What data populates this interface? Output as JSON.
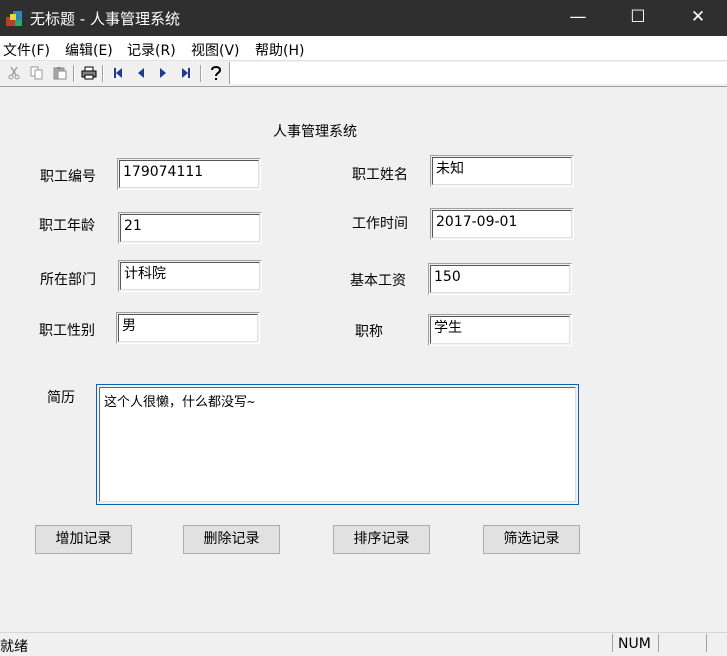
{
  "window": {
    "title": "无标题 - 人事管理系统"
  },
  "menu": [
    "文件(F)",
    "编辑(E)",
    "记录(R)",
    "视图(V)",
    "帮助(H)"
  ],
  "toolbar": {
    "icons": [
      "cut-icon",
      "copy-icon",
      "paste-icon",
      "print-icon",
      "first-record-icon",
      "prev-record-icon",
      "next-record-icon",
      "last-record-icon",
      "help-icon"
    ]
  },
  "form": {
    "heading": "人事管理系统",
    "fields": {
      "emp_id": {
        "label": "职工编号",
        "value": "179074111"
      },
      "emp_name": {
        "label": "职工姓名",
        "value": "未知"
      },
      "emp_age": {
        "label": "职工年龄",
        "value": "21"
      },
      "work_date": {
        "label": "工作时间",
        "value": "2017-09-01"
      },
      "department": {
        "label": "所在部门",
        "value": "计科院"
      },
      "base_salary": {
        "label": "基本工资",
        "value": "150"
      },
      "gender": {
        "label": "职工性别",
        "value": "男"
      },
      "title": {
        "label": "职称",
        "value": "学生"
      }
    },
    "resume": {
      "label": "简历",
      "value": "这个人很懒，什么都没写~"
    }
  },
  "buttons": {
    "add": "增加记录",
    "delete": "删除记录",
    "sort": "排序记录",
    "filter": "筛选记录"
  },
  "status": {
    "message": "就绪",
    "num": "NUM"
  }
}
